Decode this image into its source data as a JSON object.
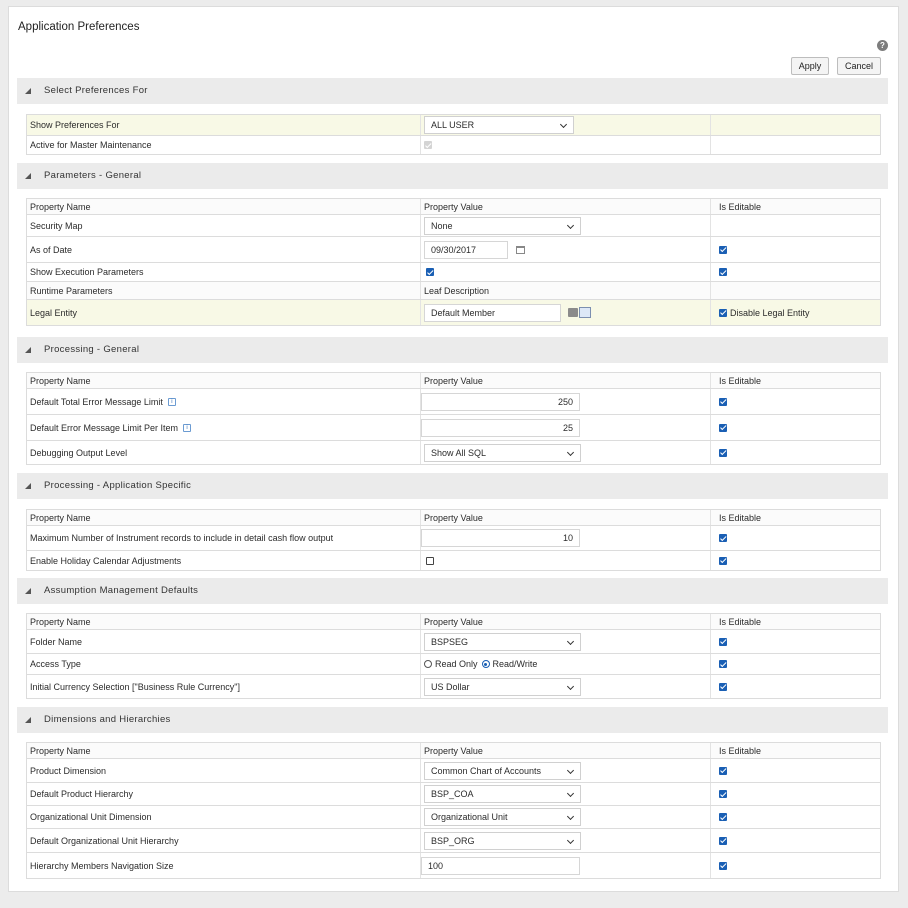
{
  "page": {
    "title": "Application Preferences",
    "help_icon": "?",
    "apply_label": "Apply",
    "cancel_label": "Cancel"
  },
  "sections": {
    "select": {
      "title": "Select Preferences For",
      "show_for_label": "Show Preferences For",
      "show_for_value": "ALL USER",
      "active_label": "Active for Master Maintenance"
    },
    "params": {
      "title": "Parameters - General",
      "col_name": "Property Name",
      "col_value": "Property Value",
      "col_editable": "Is Editable",
      "security_map_label": "Security Map",
      "security_map_value": "None",
      "as_of_date_label": "As of Date",
      "as_of_date_value": "09/30/2017",
      "show_exec_label": "Show Execution Parameters",
      "runtime_label": "Runtime Parameters",
      "leaf_desc_label": "Leaf Description",
      "legal_entity_label": "Legal Entity",
      "legal_entity_value": "Default Member",
      "disable_legal_label": "Disable Legal Entity"
    },
    "processing": {
      "title": "Processing - General",
      "col_name": "Property Name",
      "col_value": "Property Value",
      "col_editable": "Is Editable",
      "total_error_label": "Default Total Error Message Limit",
      "total_error_value": "250",
      "per_item_label": "Default Error Message Limit Per Item",
      "per_item_value": "25",
      "debug_label": "Debugging Output Level",
      "debug_value": "Show All SQL",
      "info_glyph": "i"
    },
    "app_specific": {
      "title": "Processing - Application Specific",
      "col_name": "Property Name",
      "col_value": "Property Value",
      "col_editable": "Is Editable",
      "max_records_label": "Maximum Number of Instrument records to include in detail cash flow output",
      "max_records_value": "10",
      "holiday_label": "Enable Holiday Calendar Adjustments"
    },
    "assumption": {
      "title": "Assumption Management Defaults",
      "col_name": "Property Name",
      "col_value": "Property Value",
      "col_editable": "Is Editable",
      "folder_label": "Folder Name",
      "folder_value": "BSPSEG",
      "access_label": "Access Type",
      "read_only_label": "Read Only",
      "read_write_label": "Read/Write",
      "currency_label": "Initial Currency Selection [\"Business Rule Currency\"]",
      "currency_value": "US Dollar"
    },
    "dimensions": {
      "title": "Dimensions and Hierarchies",
      "col_name": "Property Name",
      "col_value": "Property Value",
      "col_editable": "Is Editable",
      "product_dim_label": "Product Dimension",
      "product_dim_value": "Common Chart of Accounts",
      "product_hier_label": "Default Product Hierarchy",
      "product_hier_value": "BSP_COA",
      "org_dim_label": "Organizational Unit Dimension",
      "org_dim_value": "Organizational Unit",
      "org_hier_label": "Default Organizational Unit Hierarchy",
      "org_hier_value": "BSP_ORG",
      "nav_size_label": "Hierarchy Members Navigation Size",
      "nav_size_value": "100"
    }
  },
  "colors": {
    "accent": "#1a5fb4",
    "highlight_row": "#f8f9e6",
    "section_header": "#ebebeb"
  }
}
